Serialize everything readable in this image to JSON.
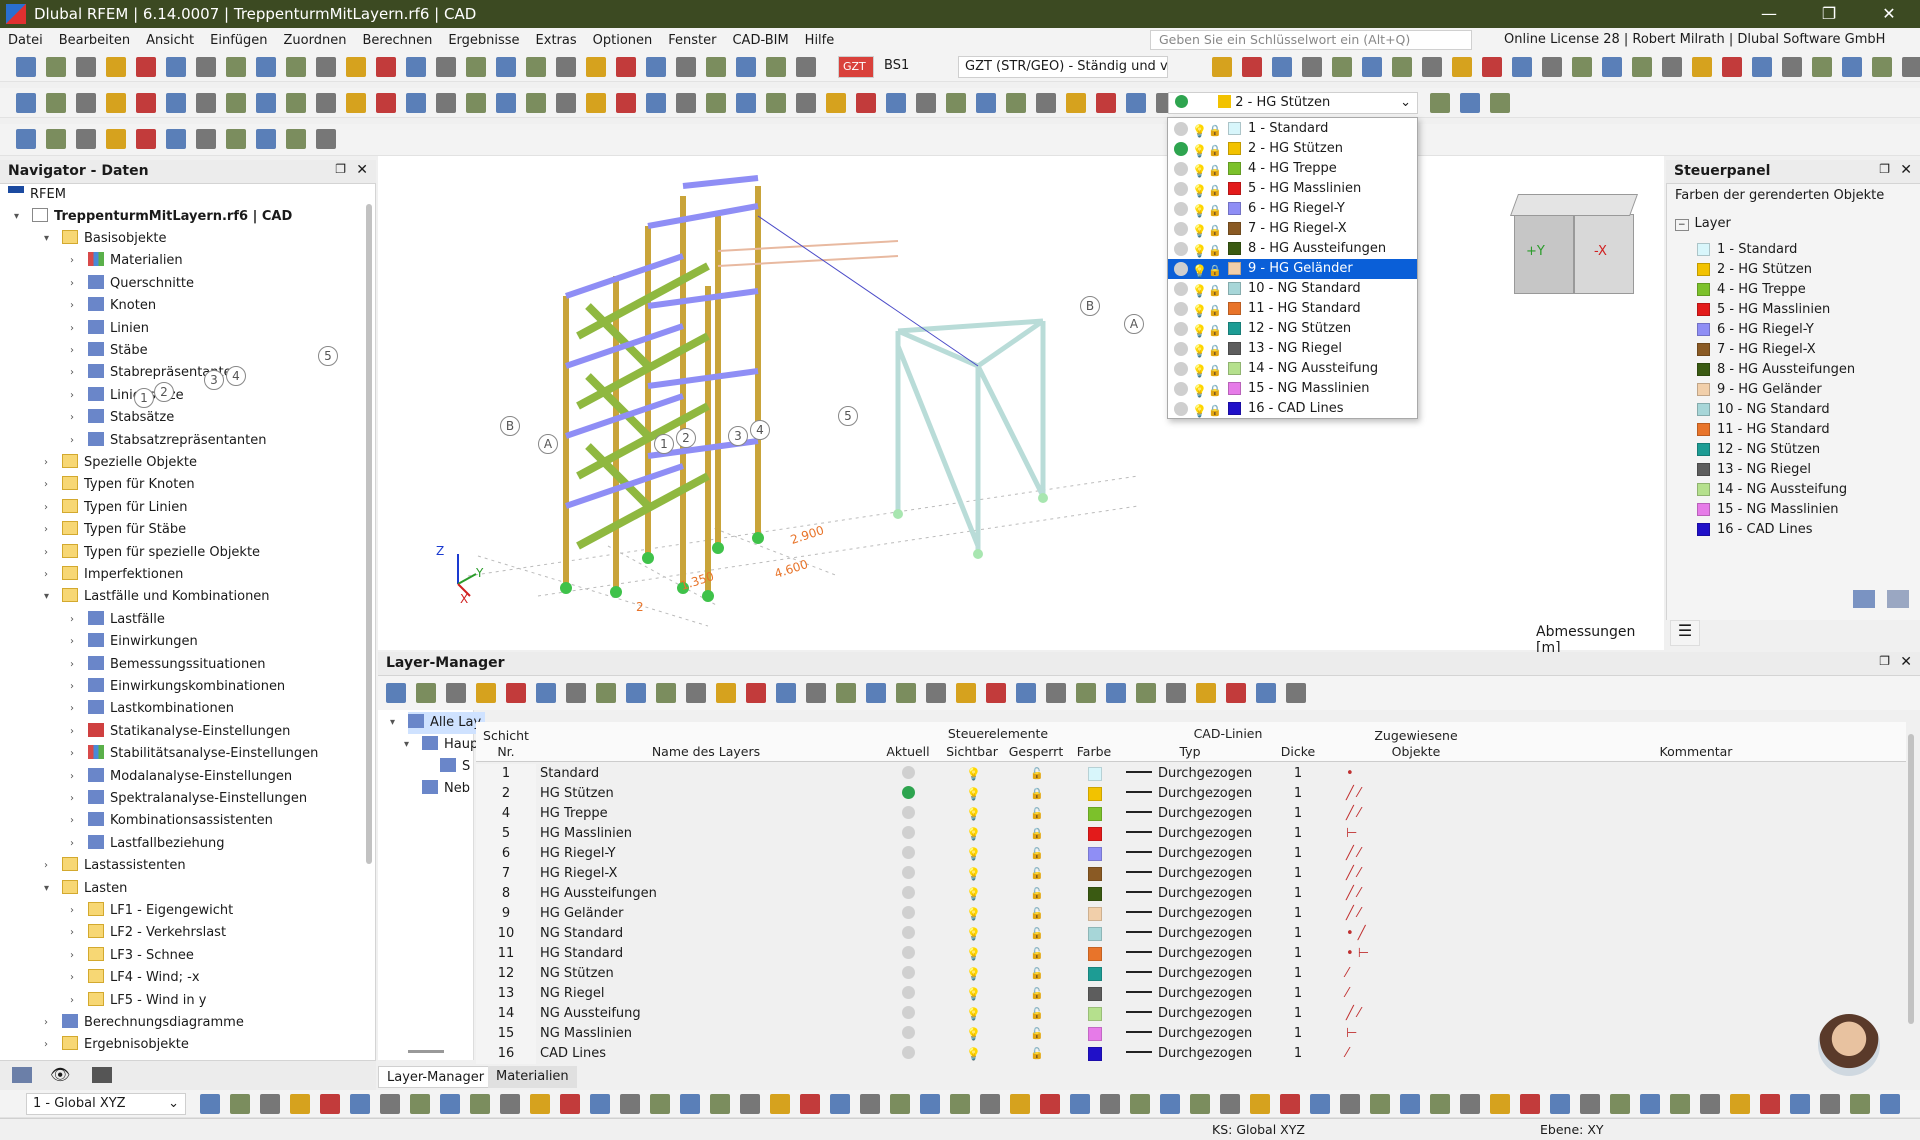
{
  "window": {
    "title": "Dlubal RFEM | 6.14.0007 | TreppenturmMitLayern.rf6 | CAD",
    "minimize": "—",
    "maximize": "❐",
    "close": "✕"
  },
  "menu": {
    "items": [
      "Datei",
      "Bearbeiten",
      "Ansicht",
      "Einfügen",
      "Zuordnen",
      "Berechnen",
      "Ergebnisse",
      "Extras",
      "Optionen",
      "Fenster",
      "CAD-BIM",
      "Hilfe"
    ],
    "search_placeholder": "Geben Sie ein Schlüsselwort ein (Alt+Q)",
    "license": "Online License 28 | Robert Milrath | Dlubal Software GmbH"
  },
  "toolbar": {
    "gzt_badge": "GZT",
    "bs": "BS1",
    "combo": "GZT (STR/GEO) - Ständig und v...",
    "layer_combo": "2 - HG Stützen",
    "global_xyz": "1 - Global XYZ"
  },
  "navigator": {
    "title": "Navigator - Daten",
    "root": "RFEM",
    "project": "TreppenturmMitLayern.rf6 | CAD",
    "items": [
      {
        "label": "Basisobjekte",
        "level": 1,
        "icon": "folder",
        "open": true
      },
      {
        "label": "Materialien",
        "level": 2,
        "icon": "materials"
      },
      {
        "label": "Querschnitte",
        "level": 2,
        "icon": "section"
      },
      {
        "label": "Knoten",
        "level": 2,
        "icon": "node"
      },
      {
        "label": "Linien",
        "level": 2,
        "icon": "line"
      },
      {
        "label": "Stäbe",
        "level": 2,
        "icon": "member"
      },
      {
        "label": "Stabrepräsentanten",
        "level": 2,
        "icon": "member"
      },
      {
        "label": "Liniensätze",
        "level": 2,
        "icon": "line"
      },
      {
        "label": "Stabsätze",
        "level": 2,
        "icon": "member"
      },
      {
        "label": "Stabsatzrepräsentanten",
        "level": 2,
        "icon": "member"
      },
      {
        "label": "Spezielle Objekte",
        "level": 1,
        "icon": "folder"
      },
      {
        "label": "Typen für Knoten",
        "level": 1,
        "icon": "folder"
      },
      {
        "label": "Typen für Linien",
        "level": 1,
        "icon": "folder"
      },
      {
        "label": "Typen für Stäbe",
        "level": 1,
        "icon": "folder"
      },
      {
        "label": "Typen für spezielle Objekte",
        "level": 1,
        "icon": "folder"
      },
      {
        "label": "Imperfektionen",
        "level": 1,
        "icon": "folder"
      },
      {
        "label": "Lastfälle und Kombinationen",
        "level": 1,
        "icon": "folder",
        "open": true
      },
      {
        "label": "Lastfälle",
        "level": 2,
        "icon": "blue"
      },
      {
        "label": "Einwirkungen",
        "level": 2,
        "icon": "blue"
      },
      {
        "label": "Bemessungssituationen",
        "level": 2,
        "icon": "blue"
      },
      {
        "label": "Einwirkungskombinationen",
        "level": 2,
        "icon": "blue"
      },
      {
        "label": "Lastkombinationen",
        "level": 2,
        "icon": "blue"
      },
      {
        "label": "Statikanalyse-Einstellungen",
        "level": 2,
        "icon": "red"
      },
      {
        "label": "Stabilitätsanalyse-Einstellungen",
        "level": 2,
        "icon": "multi"
      },
      {
        "label": "Modalanalyse-Einstellungen",
        "level": 2,
        "icon": "blue"
      },
      {
        "label": "Spektralanalyse-Einstellungen",
        "level": 2,
        "icon": "blue"
      },
      {
        "label": "Kombinationsassistenten",
        "level": 2,
        "icon": "blue"
      },
      {
        "label": "Lastfallbeziehung",
        "level": 2,
        "icon": "blue"
      },
      {
        "label": "Lastassistenten",
        "level": 1,
        "icon": "folder"
      },
      {
        "label": "Lasten",
        "level": 1,
        "icon": "folder",
        "open": true
      },
      {
        "label": "LF1 - Eigengewicht",
        "level": 2,
        "icon": "folder"
      },
      {
        "label": "LF2 - Verkehrslast",
        "level": 2,
        "icon": "folder"
      },
      {
        "label": "LF3 - Schnee",
        "level": 2,
        "icon": "folder"
      },
      {
        "label": "LF4 - Wind; -x",
        "level": 2,
        "icon": "folder"
      },
      {
        "label": "LF5 - Wind in y",
        "level": 2,
        "icon": "folder"
      },
      {
        "label": "Berechnungsdiagramme",
        "level": 1,
        "icon": "blue"
      },
      {
        "label": "Ergebnisobjekte",
        "level": 1,
        "icon": "folder"
      }
    ]
  },
  "layer_dropdown": [
    {
      "label": "1 - Standard",
      "color": "#d8f6fb",
      "active": false
    },
    {
      "label": "2 - HG Stützen",
      "color": "#f2c200",
      "active": true
    },
    {
      "label": "4 - HG Treppe",
      "color": "#7cc12b",
      "active": false
    },
    {
      "label": "5 - HG Masslinien",
      "color": "#e31b1b",
      "active": false
    },
    {
      "label": "6 - HG Riegel-Y",
      "color": "#8f8ef5",
      "active": false
    },
    {
      "label": "7 - HG Riegel-X",
      "color": "#8a5a24",
      "active": false
    },
    {
      "label": "8 - HG Aussteifungen",
      "color": "#3a5a12",
      "active": false
    },
    {
      "label": "9 - HG Geländer",
      "color": "#f1cfaa",
      "active": false,
      "selected": true
    },
    {
      "label": "10 - NG Standard",
      "color": "#a7d6d8",
      "active": false
    },
    {
      "label": "11 - HG Standard",
      "color": "#e8742a",
      "active": false
    },
    {
      "label": "12 - NG Stützen",
      "color": "#1d9c94",
      "active": false
    },
    {
      "label": "13 - NG Riegel",
      "color": "#5d5d5d",
      "active": false
    },
    {
      "label": "14 - NG Aussteifung",
      "color": "#b5e08d",
      "active": false
    },
    {
      "label": "15 - NG Masslinien",
      "color": "#e67be8",
      "active": false
    },
    {
      "label": "16 - CAD Lines",
      "color": "#2010c8",
      "active": false
    }
  ],
  "viewport": {
    "dim_label": "Abmessungen [m]",
    "cube_y": "+Y",
    "cube_x": "-X",
    "dims": [
      "2.900",
      "1.350",
      "4.600",
      "2"
    ],
    "axes": [
      "A",
      "B",
      "1",
      "2",
      "3",
      "4",
      "5"
    ],
    "axis_x": "X",
    "axis_y": "Y",
    "axis_z": "Z"
  },
  "steuerpanel": {
    "title": "Steuerpanel",
    "subtitle": "Farben der gerenderten Objekte",
    "group": "Layer",
    "items": [
      {
        "label": "1 - Standard",
        "color": "#d8f6fb"
      },
      {
        "label": "2 - HG Stützen",
        "color": "#f2c200"
      },
      {
        "label": "4 - HG Treppe",
        "color": "#7cc12b"
      },
      {
        "label": "5 - HG Masslinien",
        "color": "#e31b1b"
      },
      {
        "label": "6 - HG Riegel-Y",
        "color": "#8f8ef5"
      },
      {
        "label": "7 - HG Riegel-X",
        "color": "#8a5a24"
      },
      {
        "label": "8 - HG Aussteifungen",
        "color": "#3a5a12"
      },
      {
        "label": "9 - HG Geländer",
        "color": "#f1cfaa"
      },
      {
        "label": "10 - NG Standard",
        "color": "#a7d6d8"
      },
      {
        "label": "11 - HG Standard",
        "color": "#e8742a"
      },
      {
        "label": "12 - NG Stützen",
        "color": "#1d9c94"
      },
      {
        "label": "13 - NG Riegel",
        "color": "#5d5d5d"
      },
      {
        "label": "14 - NG Aussteifung",
        "color": "#b5e08d"
      },
      {
        "label": "15 - NG Masslinien",
        "color": "#e67be8"
      },
      {
        "label": "16 - CAD Lines",
        "color": "#2010c8"
      }
    ]
  },
  "layer_manager": {
    "title": "Layer-Manager",
    "tree": [
      "Alle Lay",
      "Haup",
      "S",
      "Neb"
    ],
    "headers": {
      "nr": "Schicht\nNr.",
      "name": "Name des Layers",
      "steuer": "Steuerelemente",
      "aktuell": "Aktuell",
      "sichtbar": "Sichtbar",
      "gesperrt": "Gesperrt",
      "farbe": "Farbe",
      "cad": "CAD-Linien",
      "typ": "Typ",
      "dicke": "Dicke",
      "zug": "Zugewiesene\nObjekte",
      "kommentar": "Kommentar"
    },
    "rows": [
      {
        "nr": "1",
        "name": "Standard",
        "aktuell": false,
        "bulb": false,
        "locked": false,
        "color": "#d8f6fb",
        "typ": "Durchgezogen",
        "dicke": "1",
        "obj": "•"
      },
      {
        "nr": "2",
        "name": "HG Stützen",
        "aktuell": true,
        "bulb": true,
        "locked": true,
        "color": "#f2c200",
        "typ": "Durchgezogen",
        "dicke": "1",
        "obj": "╱ ⁄"
      },
      {
        "nr": "4",
        "name": "HG Treppe",
        "aktuell": false,
        "bulb": false,
        "locked": false,
        "color": "#7cc12b",
        "typ": "Durchgezogen",
        "dicke": "1",
        "obj": "╱ ⁄"
      },
      {
        "nr": "5",
        "name": "HG Masslinien",
        "aktuell": false,
        "bulb": false,
        "locked": true,
        "color": "#e31b1b",
        "typ": "Durchgezogen",
        "dicke": "1",
        "obj": "⊢"
      },
      {
        "nr": "6",
        "name": "HG Riegel-Y",
        "aktuell": false,
        "bulb": true,
        "locked": false,
        "color": "#8f8ef5",
        "typ": "Durchgezogen",
        "dicke": "1",
        "obj": "╱ ⁄"
      },
      {
        "nr": "7",
        "name": "HG Riegel-X",
        "aktuell": false,
        "bulb": true,
        "locked": false,
        "color": "#8a5a24",
        "typ": "Durchgezogen",
        "dicke": "1",
        "obj": "╱ ⁄"
      },
      {
        "nr": "8",
        "name": "HG Aussteifungen",
        "aktuell": false,
        "bulb": false,
        "locked": false,
        "color": "#3a5a12",
        "typ": "Durchgezogen",
        "dicke": "1",
        "obj": "╱ ⁄"
      },
      {
        "nr": "9",
        "name": "HG Geländer",
        "aktuell": false,
        "bulb": false,
        "locked": false,
        "color": "#f1cfaa",
        "typ": "Durchgezogen",
        "dicke": "1",
        "obj": "╱ ⁄"
      },
      {
        "nr": "10",
        "name": "NG Standard",
        "aktuell": false,
        "bulb": false,
        "locked": false,
        "color": "#a7d6d8",
        "typ": "Durchgezogen",
        "dicke": "1",
        "obj": "• ╱"
      },
      {
        "nr": "11",
        "name": "HG Standard",
        "aktuell": false,
        "bulb": true,
        "locked": false,
        "color": "#e8742a",
        "typ": "Durchgezogen",
        "dicke": "1",
        "obj": "• ⊢"
      },
      {
        "nr": "12",
        "name": "NG Stützen",
        "aktuell": false,
        "bulb": false,
        "locked": false,
        "color": "#1d9c94",
        "typ": "Durchgezogen",
        "dicke": "1",
        "obj": "⁄"
      },
      {
        "nr": "13",
        "name": "NG Riegel",
        "aktuell": false,
        "bulb": false,
        "locked": false,
        "color": "#5d5d5d",
        "typ": "Durchgezogen",
        "dicke": "1",
        "obj": "⁄"
      },
      {
        "nr": "14",
        "name": "NG Aussteifung",
        "aktuell": false,
        "bulb": false,
        "locked": false,
        "color": "#b5e08d",
        "typ": "Durchgezogen",
        "dicke": "1",
        "obj": "╱ ⁄"
      },
      {
        "nr": "15",
        "name": "NG Masslinien",
        "aktuell": false,
        "bulb": false,
        "locked": false,
        "color": "#e67be8",
        "typ": "Durchgezogen",
        "dicke": "1",
        "obj": "⊢"
      },
      {
        "nr": "16",
        "name": "CAD Lines",
        "aktuell": false,
        "bulb": false,
        "locked": false,
        "color": "#2010c8",
        "typ": "Durchgezogen",
        "dicke": "1",
        "obj": "⁄"
      }
    ],
    "tabs": [
      "Layer-Manager",
      "Materialien"
    ]
  },
  "status": {
    "ks": "KS: Global XYZ",
    "ebene": "Ebene: XY"
  }
}
